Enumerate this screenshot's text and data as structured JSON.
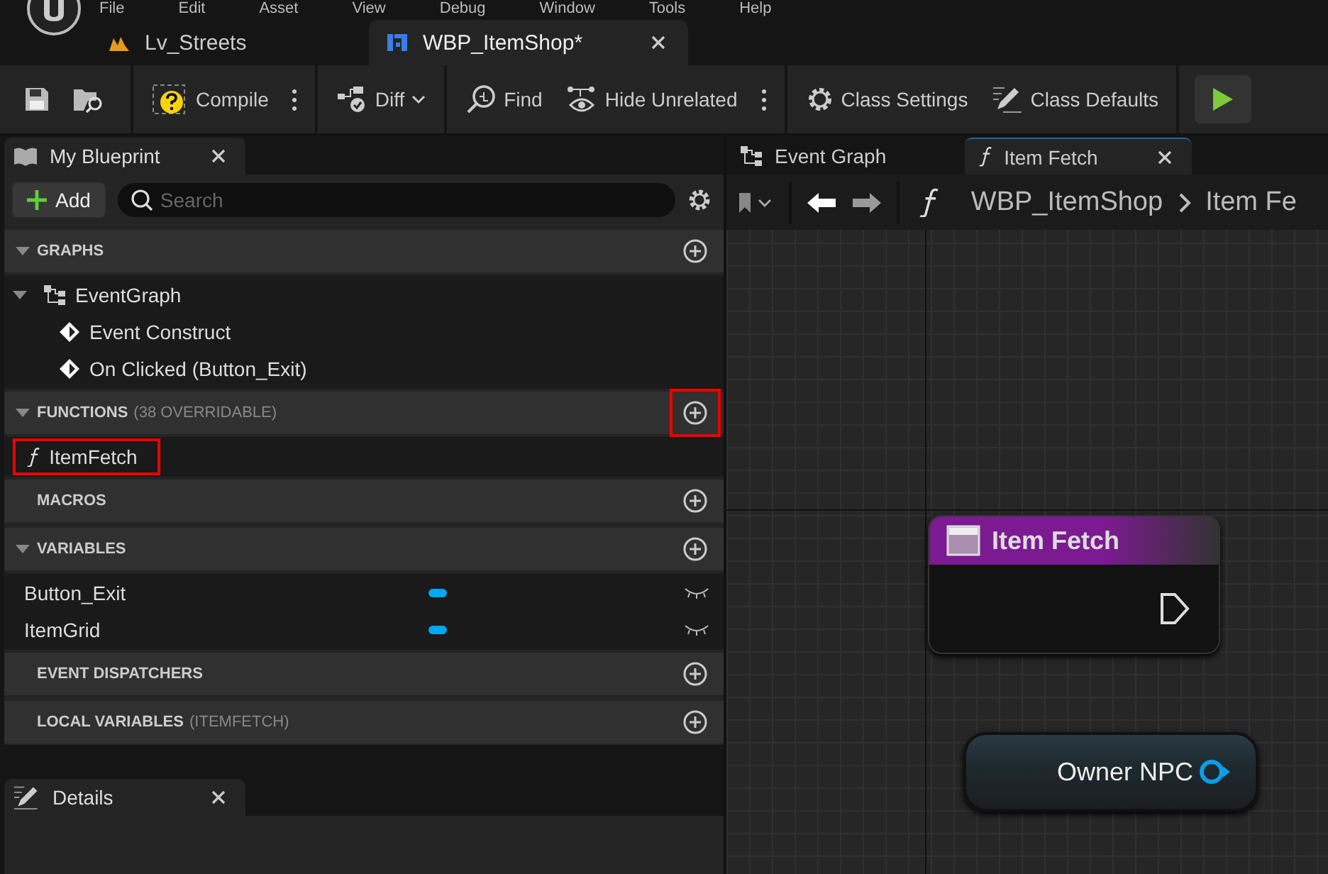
{
  "menu": [
    "File",
    "Edit",
    "Asset",
    "View",
    "Debug",
    "Window",
    "Tools",
    "Help"
  ],
  "doc_tabs": [
    {
      "label": "Lv_Streets",
      "kind": "level",
      "selected": false
    },
    {
      "label": "WBP_ItemShop*",
      "kind": "widget",
      "selected": true
    }
  ],
  "toolbar": {
    "compile": "Compile",
    "diff": "Diff",
    "find": "Find",
    "hide_unrelated": "Hide Unrelated",
    "class_settings": "Class Settings",
    "class_defaults": "Class Defaults"
  },
  "my_blueprint": {
    "title": "My Blueprint",
    "add": "Add",
    "search": {
      "placeholder": "Search"
    },
    "sections": [
      {
        "title": "GRAPHS",
        "collapsible": true,
        "add_highlighted": false,
        "items": [
          {
            "label": "EventGraph",
            "kind": "graph",
            "highlighted": false,
            "children": [
              {
                "label": "Event Construct",
                "kind": "event",
                "highlighted": false
              },
              {
                "label": "On Clicked (Button_Exit)",
                "kind": "event",
                "highlighted": false
              }
            ]
          }
        ]
      },
      {
        "title": "FUNCTIONS",
        "note": "(38 OVERRIDABLE)",
        "collapsible": true,
        "add_highlighted": true,
        "items": [
          {
            "label": "ItemFetch",
            "kind": "function",
            "highlighted": true
          }
        ]
      },
      {
        "title": "MACROS",
        "collapsible": false,
        "add_highlighted": false
      },
      {
        "title": "VARIABLES",
        "collapsible": true,
        "add_highlighted": false,
        "items": [
          {
            "label": "Button_Exit",
            "kind": "variable",
            "color": "#00a8f0",
            "highlighted": false
          },
          {
            "label": "ItemGrid",
            "kind": "variable",
            "color": "#00a8f0",
            "highlighted": false
          }
        ]
      },
      {
        "title": "EVENT DISPATCHERS",
        "collapsible": false,
        "add_highlighted": false
      },
      {
        "title": "LOCAL VARIABLES",
        "note": "(ITEMFETCH)",
        "collapsible": false,
        "add_highlighted": false
      }
    ]
  },
  "details": {
    "title": "Details"
  },
  "graph_tabs": [
    {
      "label": "Event Graph",
      "kind": "graph",
      "selected": false
    },
    {
      "label": "Item Fetch",
      "kind": "function",
      "selected": true
    }
  ],
  "breadcrumb": [
    "WBP_ItemShop",
    "Item Fe"
  ],
  "nodes": [
    {
      "kind": "function_entry",
      "title": "Item Fetch"
    },
    {
      "kind": "variable_get",
      "title": "Owner NPC",
      "color": "#0a9ee8"
    }
  ]
}
